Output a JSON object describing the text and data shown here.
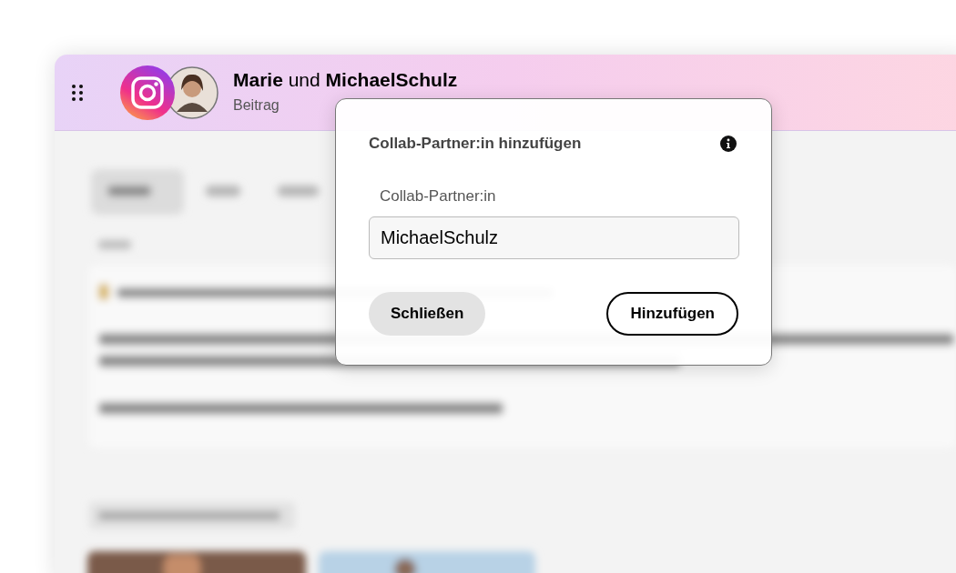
{
  "header": {
    "title": "**Marie** und **MichaelSchulz**",
    "subtitle": "Beitrag"
  },
  "dialog": {
    "title": "Collab-Partner:in hinzufügen",
    "field": {
      "label": "Collab-Partner:in",
      "value": "MichaelSchulz"
    },
    "buttons": [
      {
        "kind": "secondary",
        "label": "Schließen"
      },
      {
        "kind": "primary",
        "label": "Hinzufügen"
      }
    ]
  }
}
